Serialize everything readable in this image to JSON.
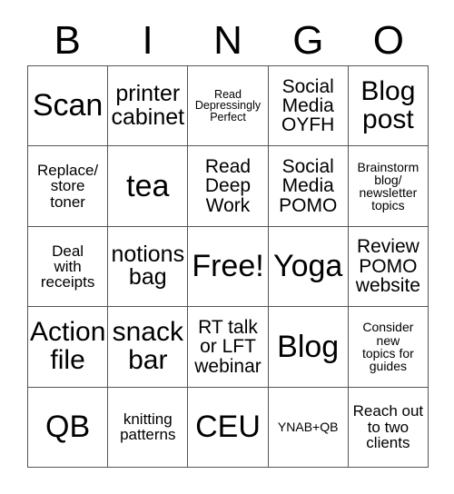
{
  "card": {
    "header_letters": [
      "B",
      "I",
      "N",
      "G",
      "O"
    ],
    "grid": {
      "rows": 5,
      "columns": 5,
      "cells": [
        {
          "text": "Scan",
          "size": "xxl"
        },
        {
          "text": "printer\ncabinet",
          "size": "lg"
        },
        {
          "text": "Read\nDepressingly\nPerfect",
          "size": "xxs"
        },
        {
          "text": "Social\nMedia\nOYFH",
          "size": "md"
        },
        {
          "text": "Blog\npost",
          "size": "xl"
        },
        {
          "text": "Replace/\nstore\ntoner",
          "size": "sm"
        },
        {
          "text": "tea",
          "size": "xxl"
        },
        {
          "text": "Read\nDeep\nWork",
          "size": "md"
        },
        {
          "text": "Social\nMedia\nPOMO",
          "size": "md"
        },
        {
          "text": "Brainstorm\nblog/\nnewsletter\ntopics",
          "size": "xs"
        },
        {
          "text": "Deal\nwith\nreceipts",
          "size": "sm"
        },
        {
          "text": "notions\nbag",
          "size": "lg"
        },
        {
          "text": "Free!",
          "size": "xxl"
        },
        {
          "text": "Yoga",
          "size": "xxl"
        },
        {
          "text": "Review\nPOMO\nwebsite",
          "size": "md"
        },
        {
          "text": "Action\nfile",
          "size": "xl"
        },
        {
          "text": "snack\nbar",
          "size": "xl"
        },
        {
          "text": "RT talk\nor LFT\nwebinar",
          "size": "md"
        },
        {
          "text": "Blog",
          "size": "xxl"
        },
        {
          "text": "Consider\nnew\ntopics for\nguides",
          "size": "xs"
        },
        {
          "text": "QB",
          "size": "xxl"
        },
        {
          "text": "knitting\npatterns",
          "size": "sm"
        },
        {
          "text": "CEU",
          "size": "xxl"
        },
        {
          "text": "YNAB+QB",
          "size": "xs"
        },
        {
          "text": "Reach out\nto two\nclients",
          "size": "sm"
        }
      ]
    }
  }
}
